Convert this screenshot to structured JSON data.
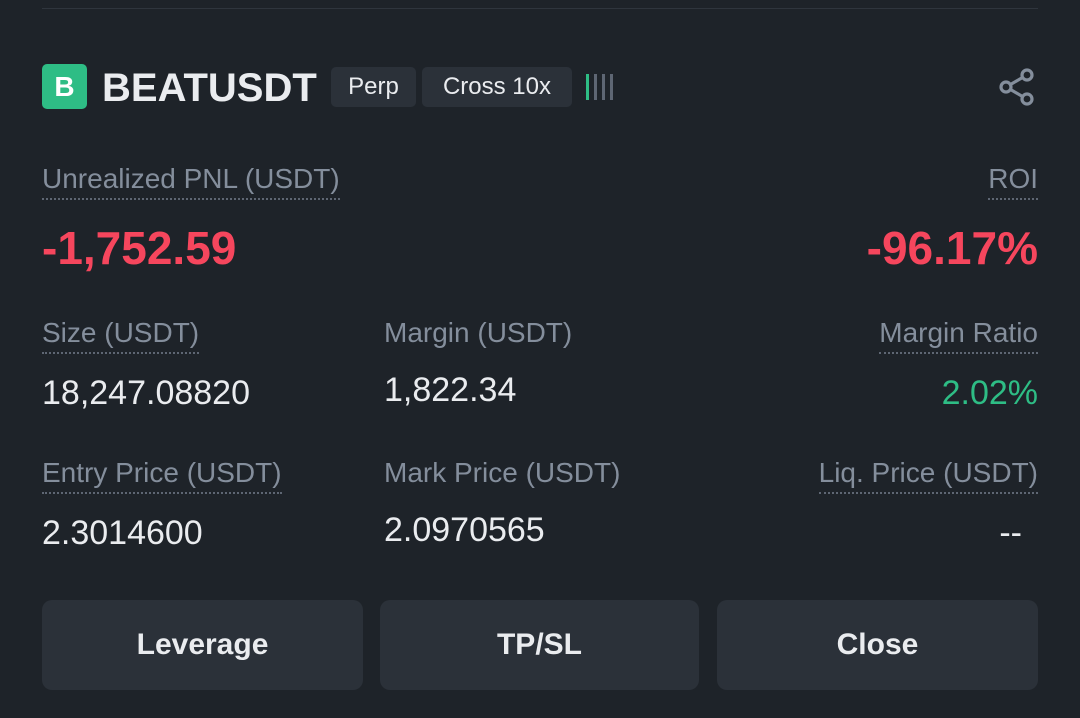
{
  "position": {
    "coin_letter": "B",
    "symbol": "BEATUSDT",
    "type_tag": "Perp",
    "margin_mode_tag": "Cross 10x",
    "risk_icon": "signal-bars-icon",
    "share_icon": "share-icon"
  },
  "pnl": {
    "label": "Unrealized PNL (USDT)",
    "value": "-1,752.59",
    "roi_label": "ROI",
    "roi_value": "-96.17%"
  },
  "stats": {
    "size_label": "Size (USDT)",
    "size_value": "18,247.08820",
    "margin_label": "Margin (USDT)",
    "margin_value": "1,822.34",
    "margin_ratio_label": "Margin Ratio",
    "margin_ratio_value": "2.02%",
    "entry_label": "Entry Price (USDT)",
    "entry_value": "2.3014600",
    "mark_label": "Mark Price (USDT)",
    "mark_value": "2.0970565",
    "liq_label": "Liq. Price (USDT)",
    "liq_value": "--"
  },
  "buttons": {
    "leverage": "Leverage",
    "tpsl": "TP/SL",
    "close": "Close"
  },
  "colors": {
    "background": "#1e2329",
    "negative": "#f6465d",
    "positive": "#2ebd85",
    "badge": "#2ebd85"
  }
}
